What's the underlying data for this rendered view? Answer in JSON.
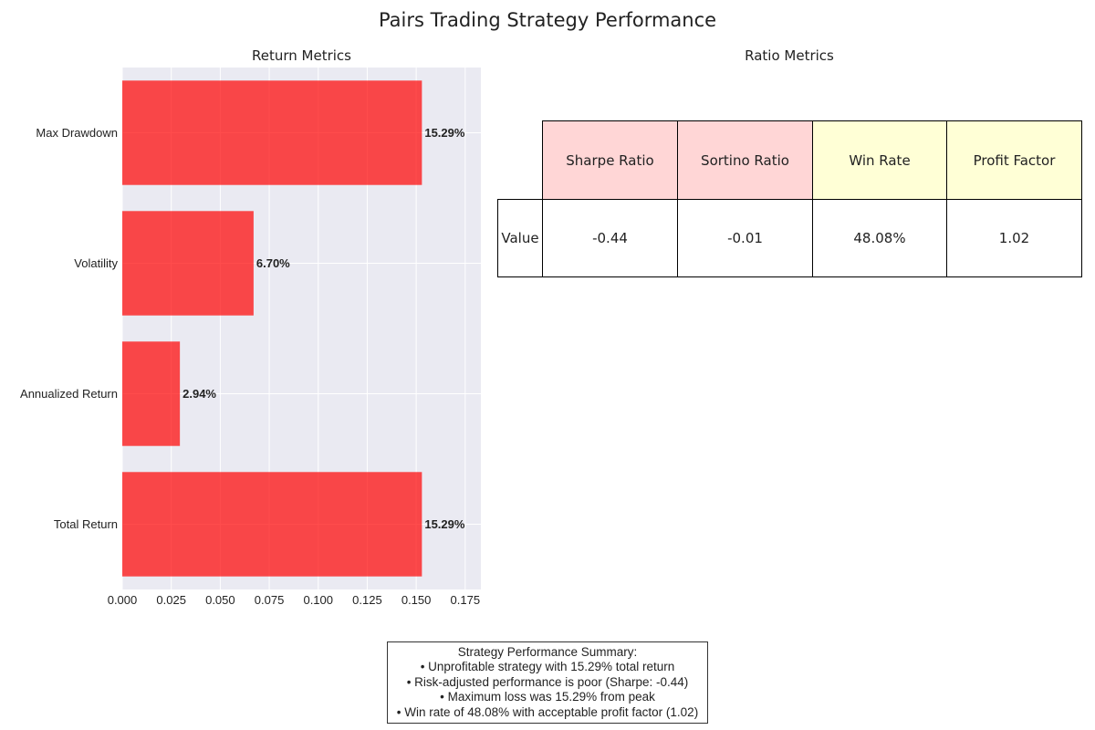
{
  "figure": {
    "title": "Pairs Trading Strategy Performance"
  },
  "chart_data": [
    {
      "type": "bar",
      "orientation": "horizontal",
      "title": "Return Metrics",
      "categories": [
        "Max Drawdown",
        "Volatility",
        "Annualized Return",
        "Total Return"
      ],
      "values": [
        0.1529,
        0.067,
        0.0294,
        0.1529
      ],
      "data_labels": [
        "15.29%",
        "6.70%",
        "2.94%",
        "15.29%"
      ],
      "xlim": [
        0,
        0.183
      ],
      "xticks": [
        0.0,
        0.025,
        0.05,
        0.075,
        0.1,
        0.125,
        0.15,
        0.175
      ],
      "xtick_labels": [
        "0.000",
        "0.025",
        "0.050",
        "0.075",
        "0.100",
        "0.125",
        "0.150",
        "0.175"
      ],
      "grid": true,
      "bar_color": "#ff0000",
      "bar_alpha": 0.7,
      "background_color": "#eaeaf2"
    },
    {
      "type": "table",
      "title": "Ratio Metrics",
      "columns": [
        "Sharpe Ratio",
        "Sortino Ratio",
        "Win Rate",
        "Profit Factor"
      ],
      "header_colors": [
        "#ffd6d6",
        "#ffd6d6",
        "#ffffd6",
        "#ffffd6"
      ],
      "rows": [
        {
          "label": "Value",
          "values": [
            "-0.44",
            "-0.01",
            "48.08%",
            "1.02"
          ]
        }
      ]
    }
  ],
  "summary": {
    "lines": [
      "Strategy Performance Summary:",
      "• Unprofitable strategy with 15.29% total return",
      "• Risk-adjusted performance is poor (Sharpe: -0.44)",
      "• Maximum loss was 15.29% from peak",
      "• Win rate of 48.08% with acceptable profit factor (1.02)"
    ]
  }
}
